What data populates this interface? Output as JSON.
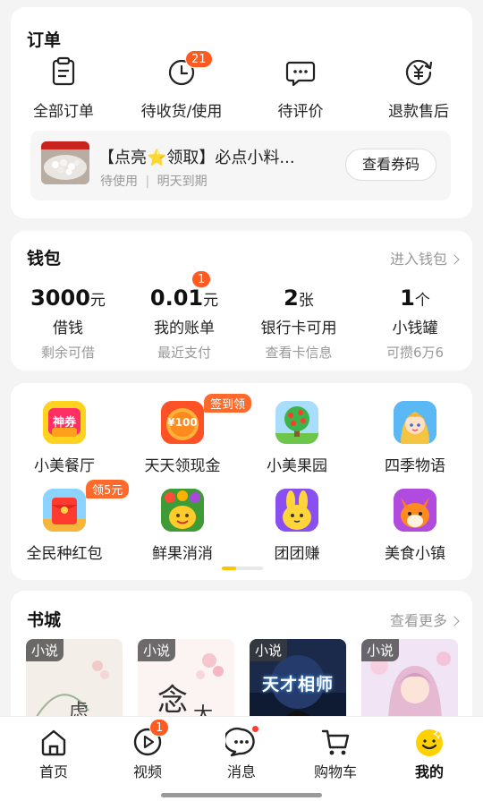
{
  "orders": {
    "title": "订单",
    "tabs": [
      {
        "label": "全部订单",
        "icon": "clipboard-icon"
      },
      {
        "label": "待收货/使用",
        "icon": "clock-icon",
        "badge": "21"
      },
      {
        "label": "待评价",
        "icon": "chat-bubble-icon"
      },
      {
        "label": "退款售后",
        "icon": "refund-yen-icon"
      }
    ],
    "coupon": {
      "title": "【点亮⭐领取】必点小料...",
      "status": "待使用",
      "expiry": "明天到期",
      "separator": "|",
      "button": "查看券码"
    }
  },
  "wallet": {
    "title": "钱包",
    "more": "进入钱包",
    "items": [
      {
        "value": "3000",
        "unit": "元",
        "name": "借钱",
        "sub": "剩余可借"
      },
      {
        "value": "0.01",
        "unit": "元",
        "name": "我的账单",
        "sub": "最近支付",
        "badge": "1"
      },
      {
        "value": "2",
        "unit": "张",
        "name": "银行卡可用",
        "sub": "查看卡信息"
      },
      {
        "value": "1",
        "unit": "个",
        "name": "小钱罐",
        "sub": "可攒6万6"
      }
    ]
  },
  "apps": {
    "items": [
      {
        "label": "小美餐厅",
        "icon": "shenquan-coupon-icon",
        "icon_text": "神券"
      },
      {
        "label": "天天领现金",
        "icon": "cash-100-icon",
        "icon_text": "¥100",
        "tag": "签到领"
      },
      {
        "label": "小美果园",
        "icon": "fruit-tree-icon"
      },
      {
        "label": "四季物语",
        "icon": "girl-avatar-icon"
      },
      {
        "label": "全民种红包",
        "icon": "red-envelope-icon",
        "tag": "领5元"
      },
      {
        "label": "鲜果消消",
        "icon": "fruit-match-icon"
      },
      {
        "label": "团团赚",
        "icon": "rabbit-icon"
      },
      {
        "label": "美食小镇",
        "icon": "fox-icon"
      }
    ]
  },
  "books": {
    "title": "书城",
    "more": "查看更多",
    "items": [
      {
        "tag": "小说"
      },
      {
        "tag": "小说"
      },
      {
        "tag": "小说",
        "cover_text": "天才相师"
      },
      {
        "tag": "小说"
      }
    ]
  },
  "nav": {
    "items": [
      {
        "label": "首页",
        "icon": "home-icon"
      },
      {
        "label": "视频",
        "icon": "video-play-icon",
        "badge": "1"
      },
      {
        "label": "消息",
        "icon": "message-icon"
      },
      {
        "label": "购物车",
        "icon": "cart-icon"
      },
      {
        "label": "我的",
        "icon": "smiley-icon",
        "active": true
      }
    ]
  },
  "colors": {
    "accent": "#ffc400",
    "badge": "#ff5a1f",
    "muted": "#999999"
  }
}
